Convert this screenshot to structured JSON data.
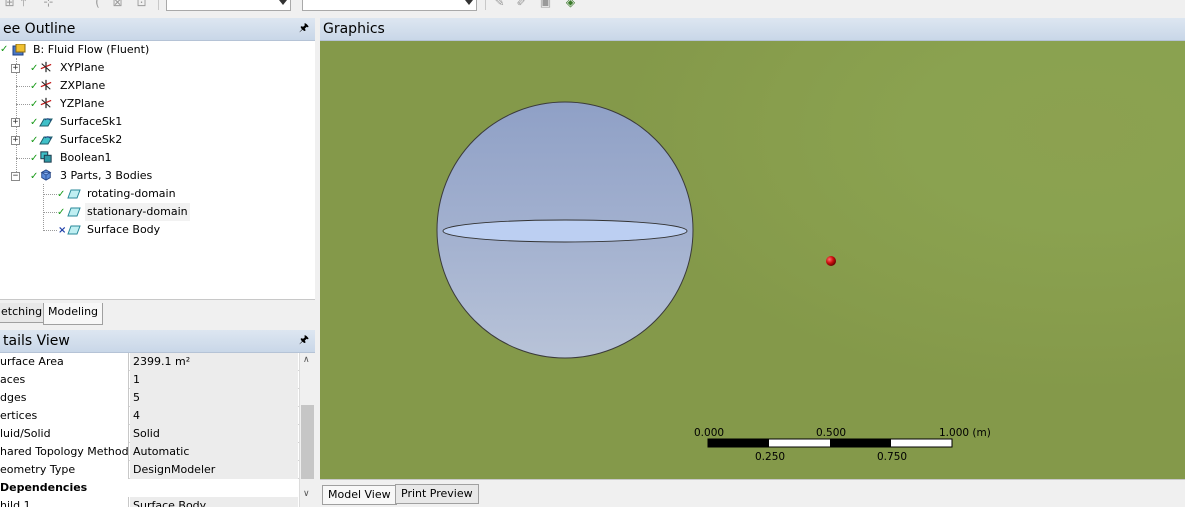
{
  "toolbar": {
    "icons": [
      "zoom-icon",
      "face-icon",
      "edge-select-icon",
      "curve-icon",
      "feature-icon",
      "select-mode-icon"
    ],
    "combo1_value": "",
    "combo2_value": "",
    "right_icons": [
      "comment-icon",
      "brush-icon",
      "camera-icon",
      "graph-icon"
    ]
  },
  "tree_outline": {
    "title": "ee Outline",
    "pin_icon": "pin-icon",
    "items": [
      {
        "label": "B: Fluid Flow (Fluent)",
        "icon": "project-icon",
        "status": "none"
      },
      {
        "label": "XYPlane",
        "icon": "plane-axis-icon",
        "status": "check"
      },
      {
        "label": "ZXPlane",
        "icon": "plane-axis-icon",
        "status": "check"
      },
      {
        "label": "YZPlane",
        "icon": "plane-axis-icon",
        "status": "check"
      },
      {
        "label": "SurfaceSk1",
        "icon": "surface-sketch-icon",
        "status": "check"
      },
      {
        "label": "SurfaceSk2",
        "icon": "surface-sketch-icon",
        "status": "check"
      },
      {
        "label": "Boolean1",
        "icon": "boolean-icon",
        "status": "check"
      },
      {
        "label": "3 Parts, 3 Bodies",
        "icon": "parts-icon",
        "status": "check"
      },
      {
        "label": "rotating-domain",
        "icon": "surface-body-icon",
        "status": "check"
      },
      {
        "label": "stationary-domain",
        "icon": "surface-body-icon",
        "status": "check"
      },
      {
        "label": "Surface Body",
        "icon": "surface-body-icon",
        "status": "x"
      }
    ]
  },
  "tabs": [
    {
      "label": "etching",
      "active": false
    },
    {
      "label": "Modeling",
      "active": true
    }
  ],
  "details_view": {
    "title": "tails View",
    "pin_icon": "pin-icon",
    "rows": [
      {
        "name": "urface Area",
        "value": "2399.1 m²"
      },
      {
        "name": "aces",
        "value": "1"
      },
      {
        "name": "dges",
        "value": "5"
      },
      {
        "name": "ertices",
        "value": "4"
      },
      {
        "name": "luid/Solid",
        "value": "Solid"
      },
      {
        "name": "hared Topology Method",
        "value": "Automatic"
      },
      {
        "name": "eometry Type",
        "value": "DesignModeler"
      }
    ],
    "group_label": "Dependencies",
    "partial_row": {
      "name": "hild 1",
      "value": "Surface Body"
    }
  },
  "graphics": {
    "title": "Graphics",
    "scale_bar": {
      "labels_top": [
        "0.000",
        "0.500",
        "1.000 (m)"
      ],
      "labels_bottom": [
        "0.250",
        "0.750"
      ]
    },
    "colors": {
      "background": "#8aa250",
      "sphere": "#a9b8d4",
      "sphere_edge": "#3a3a3a",
      "ellipse": "#bdd0f2",
      "red_point": "#cc1010"
    }
  },
  "bottom_tabs": [
    {
      "label": "Model View",
      "active": true
    },
    {
      "label": "Print Preview",
      "active": false
    }
  ]
}
